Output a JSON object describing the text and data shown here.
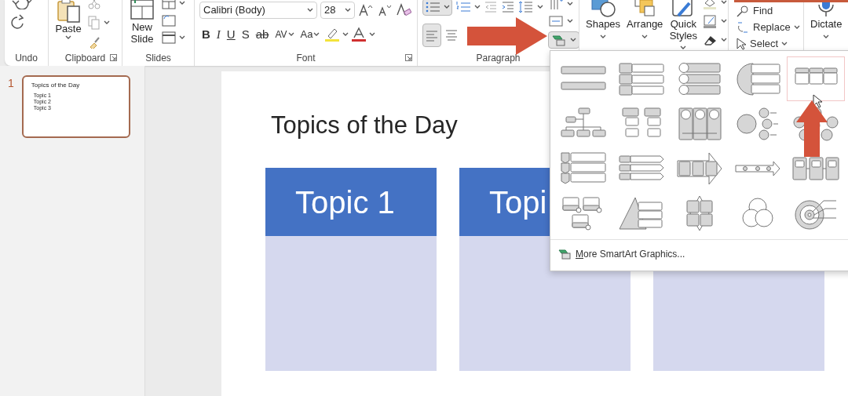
{
  "ribbon": {
    "undo_group": {
      "label": "Undo"
    },
    "clipboard": {
      "label": "Clipboard",
      "paste": "Paste"
    },
    "slides": {
      "label": "Slides",
      "new_slide": [
        "New",
        "Slide"
      ]
    },
    "font": {
      "label": "Font",
      "font_name": "Calibri (Body)",
      "font_size": "28",
      "format_buttons": [
        "B",
        "I",
        "U",
        "S",
        "ab",
        "AV",
        "Aa"
      ]
    },
    "paragraph": {
      "label": "Paragraph",
      "smartart_active": true
    },
    "drawing": {
      "shapes": "Shapes",
      "arrange": "Arrange",
      "quick_styles": [
        "Quick",
        "Styles"
      ]
    },
    "editing": {
      "find": "Find",
      "replace": "Replace",
      "select": "Select"
    },
    "voice": {
      "dictate": "Dictate"
    }
  },
  "slide_panel": {
    "slides": [
      {
        "number": "1",
        "selected": true,
        "title": "Topics of the Day",
        "bullets": [
          "Topic 1",
          "Topic 2",
          "Topic 3"
        ]
      }
    ]
  },
  "slide": {
    "title": "Topics of the Day",
    "topic_boxes": [
      {
        "kind": "header",
        "heading": "Topic 1"
      },
      {
        "kind": "header",
        "heading": "Topi"
      },
      {
        "kind": "body_only"
      }
    ]
  },
  "smartart_gallery": {
    "layouts": [
      {
        "kind": "bar-list",
        "selected": false
      },
      {
        "kind": "box-list",
        "selected": false
      },
      {
        "kind": "circle-list",
        "selected": false
      },
      {
        "kind": "arc-list",
        "selected": false
      },
      {
        "kind": "table-list",
        "selected": true
      },
      {
        "kind": "hierarchy",
        "selected": false
      },
      {
        "kind": "box-tree",
        "selected": false
      },
      {
        "kind": "circle-columns",
        "selected": false
      },
      {
        "kind": "circle-branch",
        "selected": false
      },
      {
        "kind": "circle-cycle",
        "selected": false
      },
      {
        "kind": "chevron-list",
        "selected": false
      },
      {
        "kind": "tab-rows",
        "selected": false
      },
      {
        "kind": "arrow-boxes",
        "selected": false
      },
      {
        "kind": "arrow-timeline",
        "selected": false
      },
      {
        "kind": "linked-boxes",
        "selected": false
      },
      {
        "kind": "picture-boxes",
        "selected": false
      },
      {
        "kind": "pyramid",
        "selected": false
      },
      {
        "kind": "matrix",
        "selected": false
      },
      {
        "kind": "venn",
        "selected": false
      },
      {
        "kind": "target",
        "selected": false
      }
    ],
    "more_link": "More SmartArt Graphics..."
  },
  "annotations": [
    {
      "kind": "arrow-right"
    },
    {
      "kind": "arrow-up"
    },
    {
      "kind": "bar"
    }
  ]
}
